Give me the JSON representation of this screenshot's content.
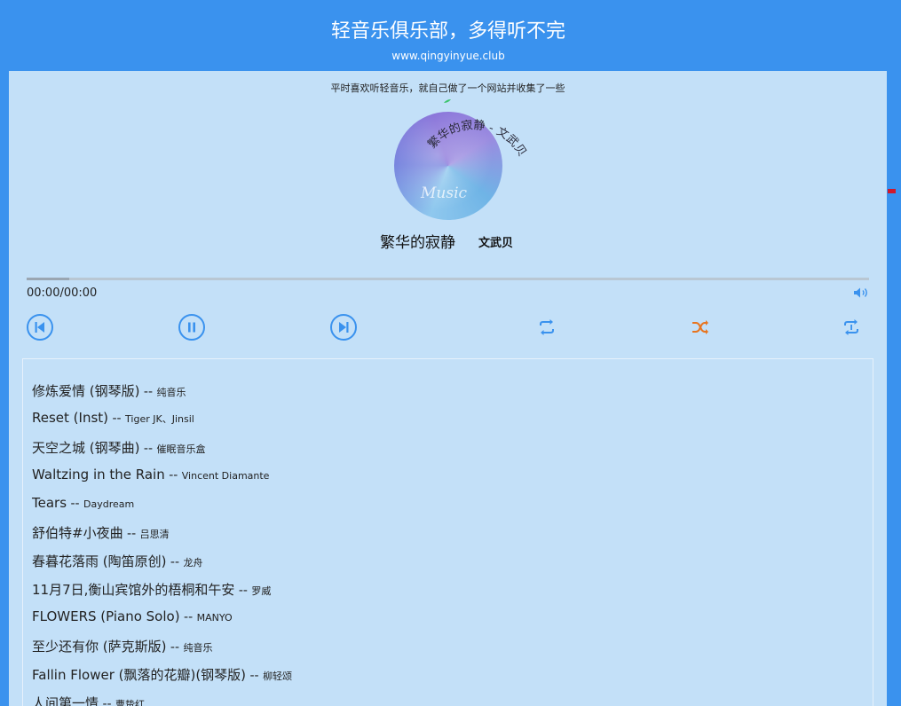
{
  "header": {
    "title": "轻音乐俱乐部，多得听不完",
    "url": "www.qingyinyue.club"
  },
  "player": {
    "tagline": "平时喜欢听轻音乐，就自己做了一个网站并收集了一些",
    "cover_text": "Music",
    "curved_text": "繁华的寂静 - 文武贝",
    "song_title": "繁华的寂静",
    "song_artist": "文武贝",
    "time": "00:00/00:00",
    "progress": 0,
    "icons": {
      "prev": "skip-previous-icon",
      "pause": "pause-icon",
      "next": "skip-next-icon",
      "repeat": "repeat-icon",
      "shuffle": "shuffle-icon",
      "repeat_one": "repeat-one-icon",
      "volume": "volume-icon"
    },
    "colors": {
      "accent": "#3a92ee",
      "shuffle_active": "#e8741e",
      "panel": "#c3e0f8"
    }
  },
  "playlist": [
    {
      "title": "修炼爱情 (钢琴版)",
      "artist": "纯音乐"
    },
    {
      "title": "Reset (Inst)",
      "artist": "Tiger JK、Jinsil"
    },
    {
      "title": "天空之城 (钢琴曲)",
      "artist": "催眠音乐盒"
    },
    {
      "title": "Waltzing in the Rain",
      "artist": "Vincent Diamante"
    },
    {
      "title": "Tears",
      "artist": "Daydream"
    },
    {
      "title": "舒伯特#小夜曲",
      "artist": "吕思清"
    },
    {
      "title": "春暮花落雨 (陶笛原创)",
      "artist": "龙舟"
    },
    {
      "title": "11月7日,衡山宾馆外的梧桐和午安",
      "artist": "罗威"
    },
    {
      "title": "FLOWERS (Piano Solo)",
      "artist": "MANYO"
    },
    {
      "title": "至少还有你 (萨克斯版)",
      "artist": "纯音乐"
    },
    {
      "title": "Fallin Flower (飘落的花瓣)(钢琴版)",
      "artist": "柳轻颂"
    },
    {
      "title": "人间第一情",
      "artist": "曹贽红"
    }
  ],
  "separator": "--"
}
